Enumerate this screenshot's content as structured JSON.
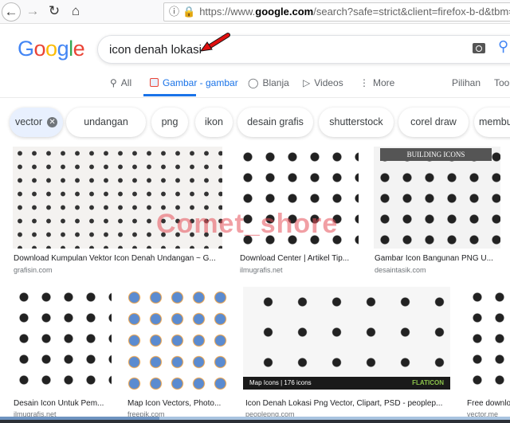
{
  "browser": {
    "url_prefix": "https://www.",
    "url_domain": "google.com",
    "url_rest": "/search?safe=strict&client=firefox-b-d&tbm=isch&"
  },
  "header": {
    "logo": "Google",
    "query": "icon denah lokasi",
    "annotation_color": "#e01010"
  },
  "tabs": [
    {
      "label": "All",
      "icon": "search-icon"
    },
    {
      "label": "Gambar - gambar",
      "icon": "image-icon",
      "active": true
    },
    {
      "label": "Blanja",
      "icon": "tag-icon"
    },
    {
      "label": "Videos",
      "icon": "play-icon"
    },
    {
      "label": "More",
      "icon": "more-vert-icon"
    },
    {
      "label": "Pilihan"
    },
    {
      "label": "Tools"
    }
  ],
  "chips": [
    "vector",
    "undangan",
    "png",
    "ikon",
    "desain grafis",
    "shutterstock",
    "corel draw",
    "membu"
  ],
  "watermark": "Comet_shore",
  "results": [
    {
      "caption": "Download Kumpulan Vektor Icon Denah Undangan ~ G...",
      "source": "grafisin.com"
    },
    {
      "caption": "Download Center | Artikel Tip...",
      "source": "ilmugrafis.net"
    },
    {
      "caption": "Gambar Icon Bangunan PNG U...",
      "source": "desaintasik.com",
      "image_text": "BUILDING ICONS"
    },
    {
      "caption": "Desain Icon Untuk Pem...",
      "source": "ilmugrafis.net"
    },
    {
      "caption": "Map Icon Vectors, Photo...",
      "source": "freepik.com"
    },
    {
      "caption": "Icon Denah Lokasi Png Vector, Clipart, PSD - peoplep...",
      "source": "peoplepng.com",
      "image_text": "Map Icons | 176 icons",
      "image_brand": "FLATICON"
    },
    {
      "caption": "Free downlo",
      "source": "vector.me"
    }
  ]
}
